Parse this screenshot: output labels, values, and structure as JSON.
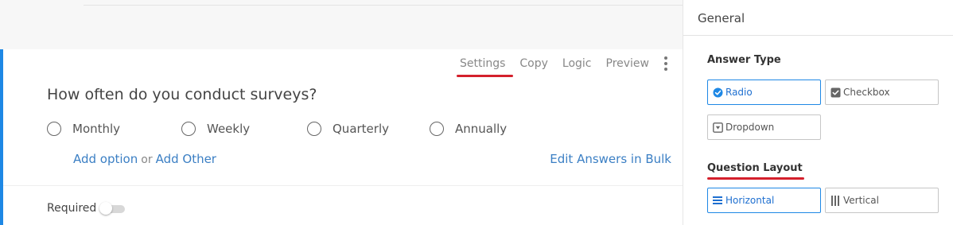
{
  "toolbar": {
    "settings": "Settings",
    "copy": "Copy",
    "logic": "Logic",
    "preview": "Preview",
    "more_icon": "vertical-ellipsis-icon"
  },
  "question": {
    "title": "How often do you conduct surveys?",
    "options": [
      {
        "label": "Monthly",
        "selected": false
      },
      {
        "label": "Weekly",
        "selected": false
      },
      {
        "label": "Quarterly",
        "selected": false
      },
      {
        "label": "Annually",
        "selected": false
      }
    ],
    "add_option": "Add option",
    "or": "or",
    "add_other": "Add Other",
    "edit_bulk": "Edit Answers in Bulk",
    "required_label": "Required",
    "required_on": false
  },
  "panel": {
    "header": "General",
    "answer_type": {
      "title": "Answer Type",
      "selected": "Radio",
      "options": [
        "Radio",
        "Checkbox",
        "Dropdown"
      ]
    },
    "question_layout": {
      "title": "Question Layout",
      "selected": "Horizontal",
      "options": [
        "Horizontal",
        "Vertical"
      ]
    }
  },
  "colors": {
    "accent": "#1e88e5",
    "highlight_underline": "#d4202c",
    "link": "#3b7fc4"
  }
}
